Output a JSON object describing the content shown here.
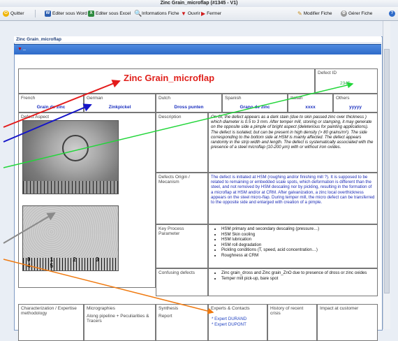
{
  "window": {
    "title": "Zinc Grain_microflap (#1345 - V1)"
  },
  "toolbar": {
    "quit": "Quitter",
    "edit_word": "Editer sous Word",
    "edit_excel": "Editer sous Excel",
    "info": "Informations Fiche",
    "open": "Ouvrir",
    "close": "Fermer",
    "modify": "Modifier Fiche",
    "manage": "Gérer Fiche",
    "help": "?"
  },
  "panel": {
    "header": "Zinc Grain_microflap",
    "bar_mark": "_"
  },
  "sheet": {
    "title": "Zinc Grain_microflap",
    "defect_id_label": "Defect ID",
    "defect_id": "2345",
    "languages": {
      "french_label": "French",
      "french": "Grain de zinc",
      "german_label": "German",
      "german": "Zinkpickel",
      "dutch_label": "Dutch",
      "dutch": "Dross punten",
      "spanish_label": "Spanish",
      "spanish": "Grano de zinc",
      "italian_label": "Italian",
      "italian": "xxxx",
      "others_label": "Others",
      "others": "yyyyy"
    },
    "defect_aspect_label": "Defect Aspect",
    "description_label": "Description",
    "description": "On GI, the defect appears as a dark stain (due to skin passed zinc over thickness ) which diameter is 0.5 to 3 mm. After temper mill, stoning or stamping, it may generate on the opposite side a pimple of bright aspect (deleterious for painting applications). The defect is isolated, but can be present in high density (> 80 grains/m²). The side corresponding to the bottom side at HSM is mainly affected. The defect appears randomly in the strip width and length. The defect is systematically associated with the presence of a steel microflap (10-200 µm) with or without iron oxides.",
    "origin_label": "Defects Origin / Mecanism",
    "origin": "The defect is initiated at HSM (roughing and/or finishing mill ?). It is supposed to be related to remaining or embedded scale spots, which deformation is different than the steel, and not removed by HSM descaling nor by pickling, resulting in the formation of a microflap at HSM and/or at CRM. After galvanization, a zinc local overthickness appears on the steel micro-flap. During temper mill, the micro defect can be transferred to the opposite side and enlarged with creation of a pimple.",
    "key_process_label": "Key Process Parameter",
    "key_process": [
      "HSM primary and secondary descaling (pressure…)",
      "HSM Skin cooling",
      "HSM lubrication",
      "HSM roll degradation",
      "Pickling conditions (T, speed, acid concentration…)",
      "Roughness at CRM"
    ],
    "confusing_label": "Confusing defects",
    "confusing": [
      "Zinc grain_dross and Zinc grain_ZnO due to presence of dross or zinc oxides",
      "Temper mill pick-up, bare spot"
    ],
    "ruler_numbers": "0 1 2 3 4 5",
    "bottom": {
      "charac_label": "Characterization / Expertise methodology",
      "micro_label": "Micrographies",
      "micro_sub": "Along pipeline + Peculiarities & Tracers",
      "synth_label": "Synthesis",
      "synth_sub": "Report",
      "experts_label": "Experts & Contacts",
      "expert1": "* Expert DURAND",
      "expert2": "* Expert DUPONT",
      "history_label": "History of recent crisis",
      "impact_label": "Impact at customer"
    }
  },
  "colors": {
    "accent_red": "#e0201b",
    "link_blue": "#1a2fbf",
    "green": "#27a745",
    "bar_blue": "#2f6bc9"
  }
}
